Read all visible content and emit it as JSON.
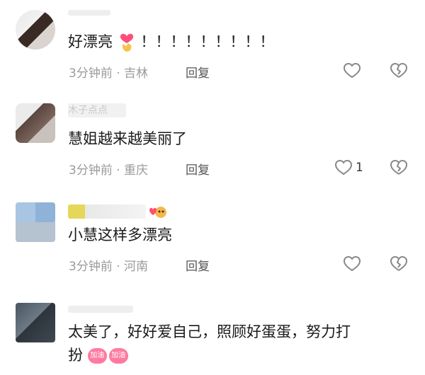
{
  "comments": [
    {
      "text_before_emoji": "好漂亮",
      "text_after_emoji": "！！！！！！！！！",
      "time": "3分钟前",
      "location": "吉林",
      "reply_label": "回复",
      "like_count": ""
    },
    {
      "username": "木子点点",
      "text": "慧姐越来越美丽了",
      "time": "3分钟前",
      "location": "重庆",
      "reply_label": "回复",
      "like_count": "1"
    },
    {
      "text": "小慧这样多漂亮",
      "time": "3分钟前",
      "location": "河南",
      "reply_label": "回复",
      "like_count": ""
    },
    {
      "text_line1": "太美了，好好爱自己，照顾好蛋蛋，努力打",
      "text_line2": "扮",
      "emoji_badges": [
        "加油",
        "加油"
      ]
    }
  ],
  "separator": " · ",
  "icons": {
    "like": "heart-outline-icon",
    "dislike": "broken-heart-icon",
    "emoji": "finger-heart-emoji"
  }
}
